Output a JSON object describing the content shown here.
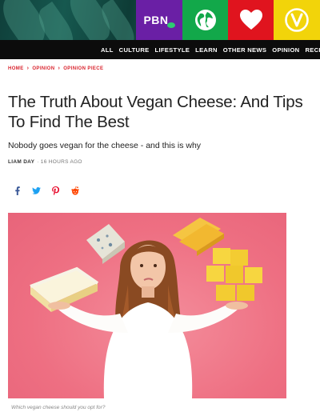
{
  "site": {
    "tiles": [
      {
        "name": "pbn-logo",
        "label": "PBN",
        "color": "#6a1fa5"
      },
      {
        "name": "world-tile",
        "icon": "globe-icon",
        "color": "#12a84a"
      },
      {
        "name": "heart-tile",
        "icon": "heart-icon",
        "color": "#e0141e"
      },
      {
        "name": "v-tile",
        "icon": "v-icon",
        "color": "#f2d40a"
      }
    ]
  },
  "nav": {
    "items": [
      "ALL",
      "CULTURE",
      "LIFESTYLE",
      "LEARN",
      "OTHER NEWS",
      "OPINION",
      "RECIPES"
    ]
  },
  "breadcrumb": {
    "items": [
      "HOME",
      "OPINION",
      "OPINION PIECE"
    ],
    "separator": "›"
  },
  "article": {
    "title": "The Truth About Vegan Cheese: And Tips To Find The Best",
    "subtitle": "Nobody goes vegan for the cheese - and this is why",
    "author": "LIAM DAY",
    "time": "· 16 HOURS AGO",
    "caption": "Which vegan cheese should  you opt for?"
  },
  "share": {
    "icons": [
      "facebook-icon",
      "twitter-icon",
      "pinterest-icon",
      "reddit-icon"
    ]
  },
  "colors": {
    "accent_red": "#d9232d",
    "nav_bg": "#0c0c0c",
    "hero_bg": "#ee6f82"
  }
}
